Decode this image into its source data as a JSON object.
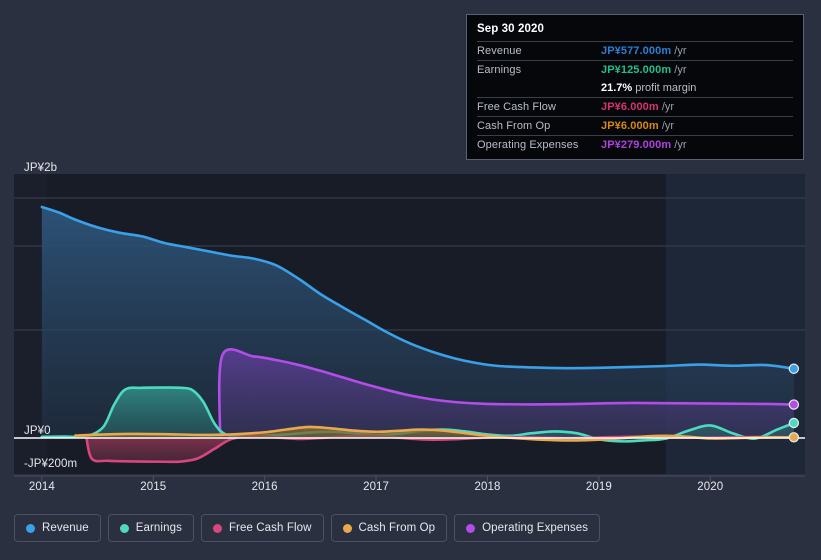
{
  "theme": {
    "page_bg": "#2b3040",
    "plot_bg": "#1a1f2b",
    "plot_bg_data": "#171c27",
    "highlight_bg": "#1d2738",
    "grid": "#3b4250",
    "baseline": "#ffffff",
    "text": "#e6e8ec"
  },
  "tooltip": {
    "date": "Sep 30 2020",
    "rows": [
      {
        "label": "Revenue",
        "amount": "JP¥577.000m",
        "unit": "/yr",
        "color": "#2a7fd4"
      },
      {
        "label": "Earnings",
        "amount": "JP¥125.000m",
        "unit": "/yr",
        "color": "#1fbf8f"
      },
      {
        "label": "Free Cash Flow",
        "amount": "JP¥6.000m",
        "unit": "/yr",
        "color": "#d6336c"
      },
      {
        "label": "Cash From Op",
        "amount": "JP¥6.000m",
        "unit": "/yr",
        "color": "#d68910"
      },
      {
        "label": "Operating Expenses",
        "amount": "JP¥279.000m",
        "unit": "/yr",
        "color": "#b040e0"
      }
    ],
    "profit_margin_value": "21.7%",
    "profit_margin_label": "profit margin"
  },
  "legend": {
    "items": [
      {
        "label": "Revenue",
        "color": "#3aa0e8"
      },
      {
        "label": "Earnings",
        "color": "#4ddbc0"
      },
      {
        "label": "Free Cash Flow",
        "color": "#d9467e"
      },
      {
        "label": "Cash From Op",
        "color": "#e8a84e"
      },
      {
        "label": "Operating Expenses",
        "color": "#b24de8"
      }
    ]
  },
  "chart_data": {
    "type": "area",
    "title": "",
    "xlabel": "",
    "ylabel": "",
    "currency": "JP¥",
    "grid": true,
    "legend_position": "bottom",
    "x_ticks": [
      "2014",
      "2015",
      "2016",
      "2017",
      "2018",
      "2019",
      "2020"
    ],
    "x_tick_values": [
      2014,
      2015,
      2016,
      2017,
      2018,
      2019,
      2020
    ],
    "y_ticks": [
      {
        "label": "JP¥2b",
        "value": 2000
      },
      {
        "label": "JP¥0",
        "value": 0
      },
      {
        "label": "-JP¥200m",
        "value": -200
      }
    ],
    "y_gridlines": [
      2000,
      1600,
      900,
      0
    ],
    "ylim": [
      -300,
      2200
    ],
    "xlim": [
      2013.75,
      2020.85
    ],
    "units": "millions of JPY",
    "highlight_from": 2019.6,
    "series": [
      {
        "name": "Revenue",
        "color": "#3aa0e8",
        "fill_top": "#2e577e",
        "fill_bottom": "#233449",
        "end_dot": true,
        "x": [
          2014.0,
          2014.15,
          2014.3,
          2014.5,
          2014.7,
          2014.9,
          2015.1,
          2015.3,
          2015.5,
          2015.7,
          2015.9,
          2016.1,
          2016.3,
          2016.5,
          2016.7,
          2016.9,
          2017.1,
          2017.3,
          2017.5,
          2017.7,
          2017.9,
          2018.1,
          2018.4,
          2018.7,
          2019.0,
          2019.3,
          2019.6,
          2019.9,
          2020.2,
          2020.5,
          2020.75
        ],
        "values": [
          1925,
          1880,
          1820,
          1755,
          1710,
          1680,
          1625,
          1590,
          1555,
          1520,
          1495,
          1440,
          1330,
          1200,
          1090,
          985,
          880,
          790,
          720,
          665,
          625,
          600,
          588,
          582,
          585,
          592,
          600,
          612,
          602,
          608,
          577
        ]
      },
      {
        "name": "Operating Expenses",
        "color": "#b24de8",
        "fill_top": "#5b3d94",
        "fill_bottom": "#3c3560",
        "end_dot": true,
        "start_step": true,
        "x": [
          2015.6,
          2015.62,
          2015.9,
          2016.1,
          2016.3,
          2016.5,
          2016.7,
          2016.9,
          2017.1,
          2017.3,
          2017.5,
          2017.7,
          2017.9,
          2018.1,
          2018.4,
          2018.7,
          2019.0,
          2019.3,
          2019.6,
          2019.9,
          2020.2,
          2020.5,
          2020.75
        ],
        "values": [
          0,
          690,
          680,
          650,
          610,
          560,
          505,
          450,
          400,
          355,
          322,
          300,
          288,
          282,
          280,
          282,
          288,
          292,
          290,
          288,
          286,
          284,
          279
        ]
      },
      {
        "name": "Earnings",
        "color": "#4ddbc0",
        "fill_top": "#2f8a85",
        "fill_bottom": "#2a5f63",
        "end_dot": true,
        "x": [
          2014.0,
          2014.2,
          2014.4,
          2014.55,
          2014.65,
          2014.75,
          2014.9,
          2015.1,
          2015.25,
          2015.35,
          2015.45,
          2015.55,
          2015.65,
          2015.8,
          2016.0,
          2016.2,
          2016.4,
          2016.6,
          2016.8,
          2017.0,
          2017.2,
          2017.4,
          2017.6,
          2017.8,
          2018.0,
          2018.2,
          2018.4,
          2018.6,
          2018.8,
          2019.0,
          2019.2,
          2019.4,
          2019.6,
          2019.8,
          2020.0,
          2020.2,
          2020.4,
          2020.6,
          2020.75
        ],
        "values": [
          10,
          12,
          14,
          90,
          280,
          405,
          418,
          420,
          418,
          400,
          300,
          120,
          30,
          22,
          20,
          30,
          45,
          52,
          40,
          25,
          35,
          60,
          70,
          55,
          30,
          18,
          40,
          55,
          40,
          -10,
          -28,
          -20,
          -5,
          60,
          105,
          40,
          -5,
          70,
          125
        ]
      },
      {
        "name": "Free Cash Flow",
        "color": "#d9467e",
        "fill_top": "#8a3350",
        "fill_bottom": "#6b3046",
        "end_dot": false,
        "x": [
          2014.4,
          2014.45,
          2014.6,
          2014.9,
          2015.1,
          2015.25,
          2015.4,
          2015.55,
          2015.7,
          2015.9,
          2016.1,
          2016.3,
          2016.5,
          2016.7,
          2016.9,
          2017.1,
          2017.3,
          2017.5,
          2017.7,
          2017.9,
          2018.1,
          2018.4,
          2018.7,
          2019.0,
          2019.3,
          2019.6,
          2019.9,
          2020.2,
          2020.5,
          2020.75
        ],
        "values": [
          0,
          -175,
          -190,
          -196,
          -198,
          -196,
          -170,
          -90,
          -10,
          18,
          5,
          -8,
          0,
          12,
          18,
          10,
          -5,
          -14,
          -10,
          0,
          8,
          4,
          -2,
          4,
          10,
          6,
          2,
          6,
          8,
          6
        ]
      },
      {
        "name": "Cash From Op",
        "color": "#e8a84e",
        "fill_top": "#8a6a32",
        "fill_bottom": "#6b552e",
        "end_dot": true,
        "x": [
          2014.3,
          2014.5,
          2014.8,
          2015.1,
          2015.4,
          2015.7,
          2016.0,
          2016.2,
          2016.4,
          2016.6,
          2016.8,
          2017.0,
          2017.2,
          2017.4,
          2017.6,
          2017.8,
          2018.0,
          2018.2,
          2018.4,
          2018.6,
          2018.8,
          2019.0,
          2019.2,
          2019.4,
          2019.6,
          2019.8,
          2020.0,
          2020.2,
          2020.4,
          2020.6,
          2020.75
        ],
        "values": [
          20,
          28,
          34,
          32,
          26,
          30,
          48,
          72,
          92,
          80,
          62,
          52,
          60,
          70,
          62,
          40,
          18,
          2,
          -10,
          -18,
          -20,
          -14,
          -2,
          12,
          18,
          10,
          -4,
          -2,
          4,
          6,
          6
        ]
      }
    ]
  }
}
